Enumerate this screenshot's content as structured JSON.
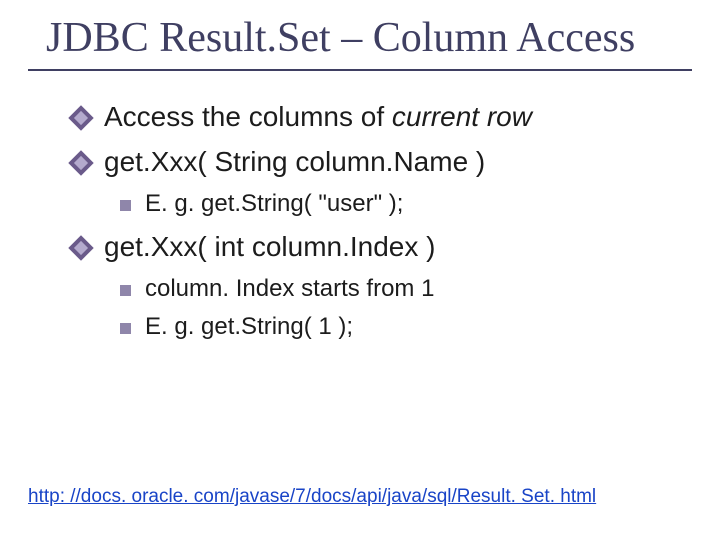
{
  "title": "JDBC Result.Set – Column Access",
  "bullets": {
    "b1_prefix": "Access the columns of ",
    "b1_italic": "current row",
    "b2": "get.Xxx( String column.Name )",
    "b2_1": "E. g. get.String( \"user\" );",
    "b3": "get.Xxx( int column.Index )",
    "b3_1": "column. Index starts from 1",
    "b3_2": "E. g. get.String( 1 );"
  },
  "footer_link": "http: //docs. oracle. com/javase/7/docs/api/java/sql/Result. Set. html"
}
